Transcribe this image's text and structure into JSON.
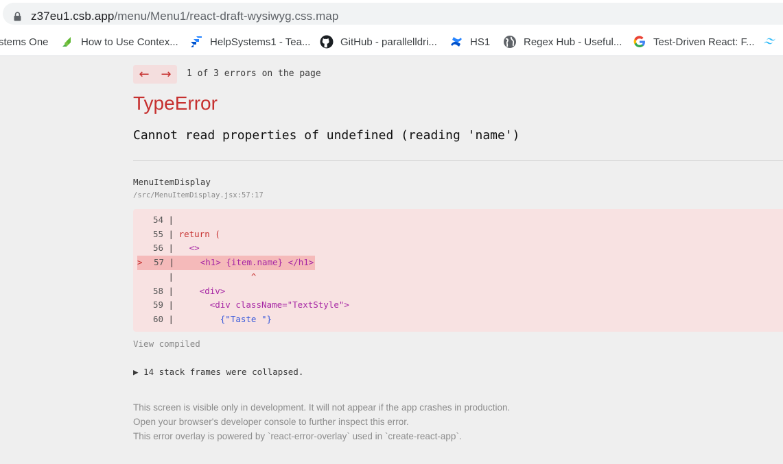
{
  "browser": {
    "url_host": "z37eu1.csb.app",
    "url_path": "/menu/Menu1/react-draft-wysiwyg.css.map"
  },
  "bookmarks": [
    {
      "label": "stems One",
      "icon": "none"
    },
    {
      "label": "How to Use Contex...",
      "icon": "green-logo-icon"
    },
    {
      "label": "HelpSystems1 - Tea...",
      "icon": "jira-icon"
    },
    {
      "label": "GitHub - parallelldri...",
      "icon": "github-icon"
    },
    {
      "label": "HS1",
      "icon": "confluence-icon"
    },
    {
      "label": "Regex Hub - Useful...",
      "icon": "globe-icon"
    },
    {
      "label": "Test-Driven React: F...",
      "icon": "google-icon"
    }
  ],
  "overlay": {
    "prev_arrow": "←",
    "next_arrow": "→",
    "error_count": "1 of 3 errors on the page",
    "error_type": "TypeError",
    "error_message": "Cannot read properties of undefined (reading 'name')",
    "function_name": "MenuItemDisplay",
    "file_path": "/src/MenuItemDisplay.jsx:57:17",
    "code_lines": [
      {
        "num": "54",
        "pre": "",
        "text": ""
      },
      {
        "num": "55",
        "pre": "",
        "text": "return ("
      },
      {
        "num": "56",
        "pre": "",
        "text": "  <>"
      },
      {
        "num": "57",
        "pre": "> ",
        "text": "    <h1> {item.name} </h1>",
        "highlight": true
      },
      {
        "num": "",
        "pre": "",
        "text": "              ^"
      },
      {
        "num": "58",
        "pre": "",
        "text": "    <div>"
      },
      {
        "num": "59",
        "pre": "",
        "text": "      <div className=\"TextStyle\">"
      },
      {
        "num": "60",
        "pre": "",
        "text": "        {\"Taste \"}"
      }
    ],
    "view_compiled": "View compiled",
    "stack_frames": "▶ 14 stack frames were collapsed.",
    "footer_lines": [
      "This screen is visible only in development. It will not appear if the app crashes in production.",
      "Open your browser's developer console to further inspect this error.",
      "This error overlay is powered by `react-error-overlay` used in `create-react-app`."
    ]
  },
  "colors": {
    "error_red": "#c6302f",
    "code_bg": "#f8e2e2",
    "highlight_bg": "#f5baba"
  }
}
